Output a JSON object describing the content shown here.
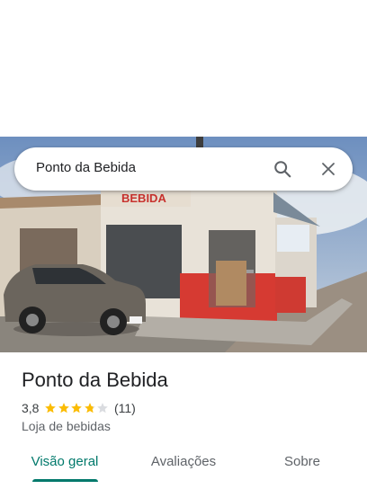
{
  "search": {
    "query": "Ponto da Bebida",
    "search_icon": "search-icon",
    "close_icon": "close-icon"
  },
  "photo": {
    "sign_text": "BEBIDA",
    "description_icon": "storefront-photo"
  },
  "place": {
    "title": "Ponto da Bebida",
    "rating": "3,8",
    "rating_value": 3.8,
    "stars_max": 5,
    "review_count": "(11)",
    "category": "Loja de bebidas"
  },
  "tabs": [
    {
      "label": "Visão geral",
      "active": true
    },
    {
      "label": "Avaliações",
      "active": false
    },
    {
      "label": "Sobre",
      "active": false
    }
  ],
  "colors": {
    "accent": "#00796b",
    "star": "#fbbc04",
    "star_empty": "#dadce0"
  }
}
